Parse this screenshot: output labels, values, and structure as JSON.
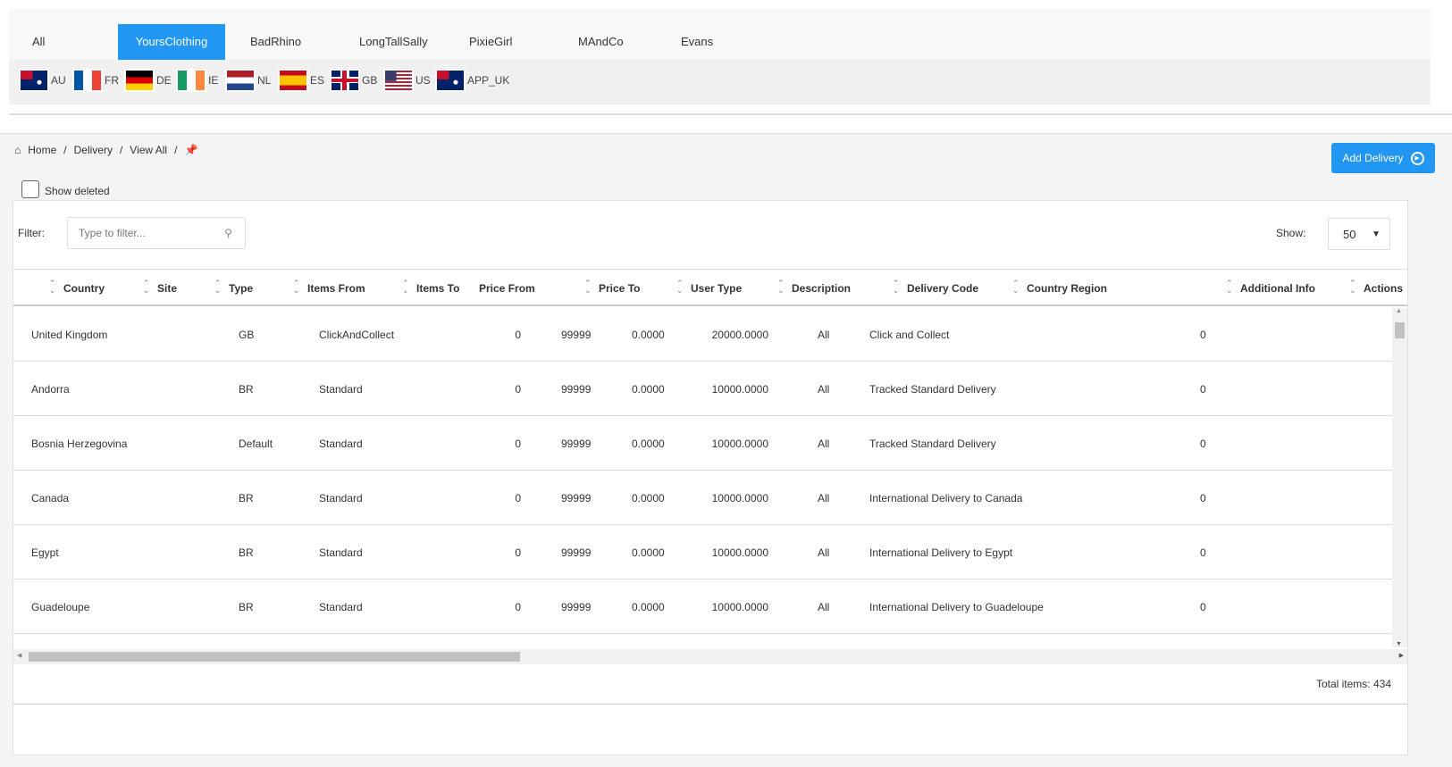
{
  "brands": {
    "tabs": [
      "All",
      "YoursClothing",
      "BadRhino",
      "LongTallSally",
      "PixieGirl",
      "MAndCo",
      "Evans"
    ],
    "active": "YoursClothing"
  },
  "flags": [
    "AU",
    "FR",
    "DE",
    "IE",
    "NL",
    "ES",
    "GB",
    "US",
    "APP_UK"
  ],
  "breadcrumb": {
    "home": "Home",
    "delivery": "Delivery",
    "view_all": "View All",
    "sep": "/"
  },
  "add_delivery": "Add Delivery",
  "show_deleted": "Show deleted",
  "filter": {
    "label": "Filter:",
    "placeholder": "Type to filter..."
  },
  "show": {
    "label": "Show:",
    "value": "50"
  },
  "columns": [
    "Country",
    "Site",
    "Type",
    "Items From",
    "Items To",
    "Price From",
    "Price To",
    "User Type",
    "Description",
    "Delivery Code",
    "Country Region",
    "Additional Info",
    "Actions"
  ],
  "rows": [
    [
      "United Kingdom",
      "GB",
      "ClickAndCollect",
      "0",
      "99999",
      "0.0000",
      "20000.0000",
      "All",
      "Click and Collect",
      "0"
    ],
    [
      "Andorra",
      "BR",
      "Standard",
      "0",
      "99999",
      "0.0000",
      "10000.0000",
      "All",
      "Tracked Standard Delivery",
      "0"
    ],
    [
      "Bosnia Herzegovina",
      "Default",
      "Standard",
      "0",
      "99999",
      "0.0000",
      "10000.0000",
      "All",
      "Tracked Standard Delivery",
      "0"
    ],
    [
      "Canada",
      "BR",
      "Standard",
      "0",
      "99999",
      "0.0000",
      "10000.0000",
      "All",
      "International Delivery to Canada",
      "0"
    ],
    [
      "Egypt",
      "BR",
      "Standard",
      "0",
      "99999",
      "0.0000",
      "10000.0000",
      "All",
      "International Delivery to Egypt",
      "0"
    ],
    [
      "Guadeloupe",
      "BR",
      "Standard",
      "0",
      "99999",
      "0.0000",
      "10000.0000",
      "All",
      "International Delivery to Guadeloupe",
      "0"
    ]
  ],
  "total": "Total items: 434",
  "colors": {
    "accent": "#2196f3"
  }
}
